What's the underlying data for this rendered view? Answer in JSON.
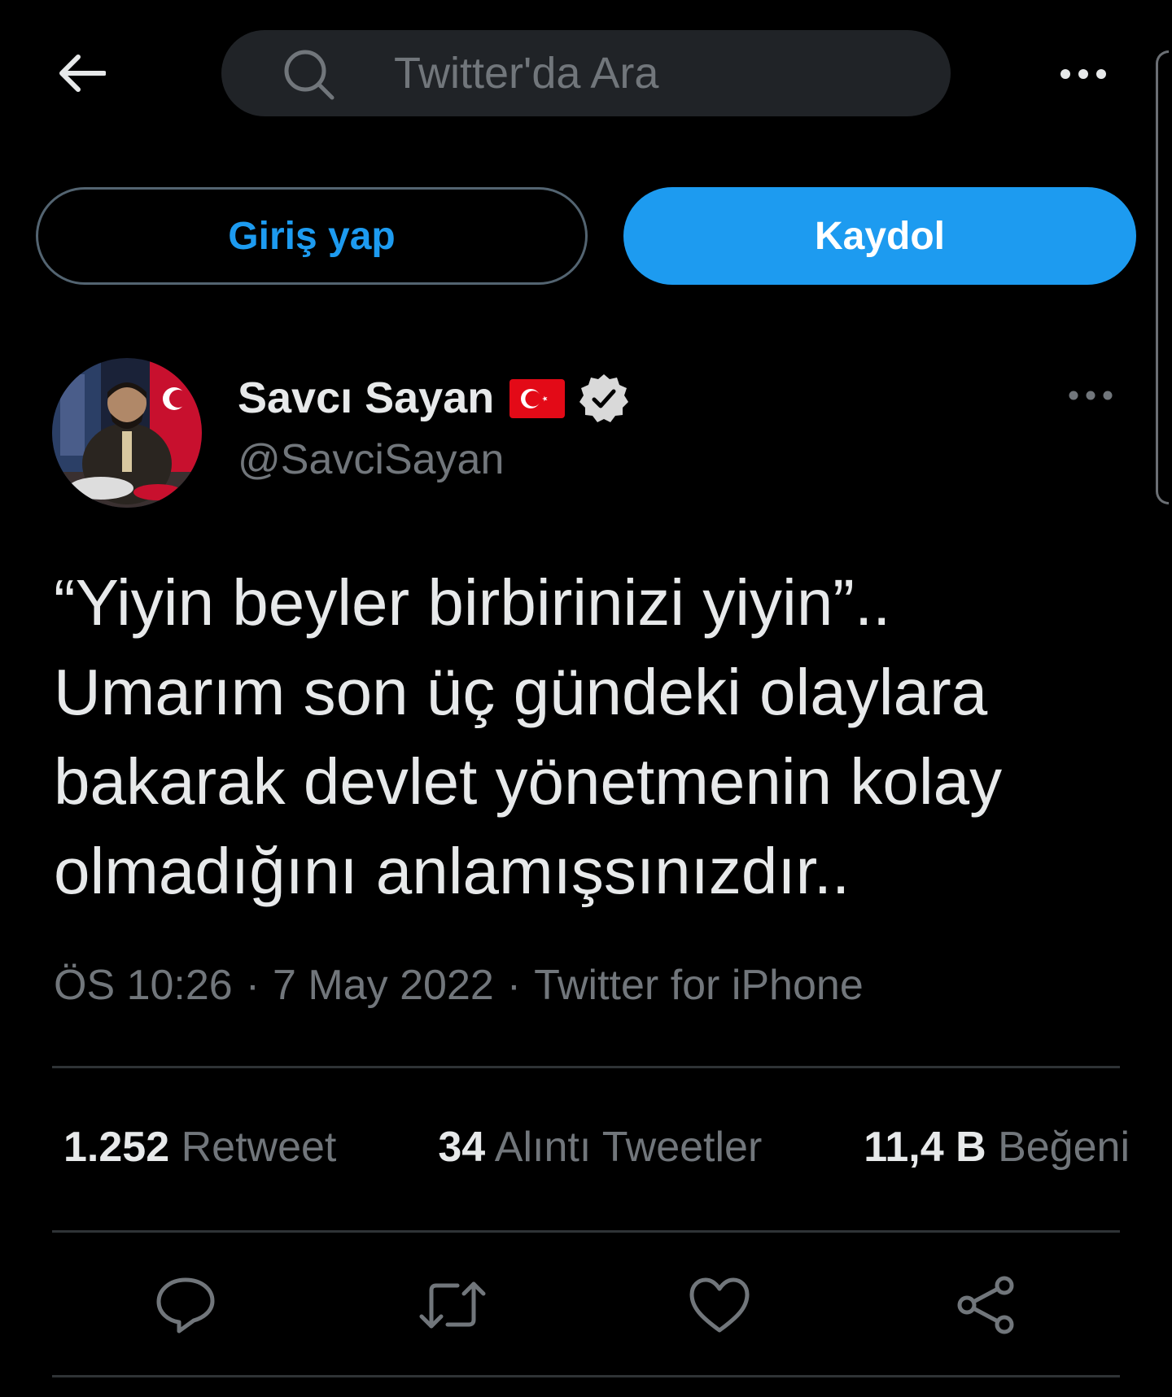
{
  "topbar": {
    "search_placeholder": "Twitter'da Ara"
  },
  "auth": {
    "login_label": "Giriş yap",
    "signup_label": "Kaydol"
  },
  "author": {
    "display_name": "Savcı Sayan",
    "handle": "@SavciSayan",
    "badges": [
      "turkey-flag-icon",
      "verified-badge-icon"
    ]
  },
  "tweet": {
    "text": "“Yiyin beyler birbirinizi yiyin”..\nUmarım son üç gündeki olaylara bakarak devlet yönetmenin kolay olmadığını anlamışsınızdır..",
    "time": "ÖS 10:26",
    "date": "7 May 2022",
    "source": "Twitter for iPhone",
    "separator": "·"
  },
  "stats": {
    "retweets_count": "1.252",
    "retweets_label": "Retweet",
    "quotes_count": "34",
    "quotes_label": "Alıntı Tweetler",
    "likes_count": "11,4 B",
    "likes_label": "Beğeni"
  },
  "actions": [
    "reply-icon",
    "retweet-icon",
    "like-icon",
    "share-icon"
  ],
  "colors": {
    "background": "#000000",
    "accent": "#1d9bf0",
    "text_primary": "#e7e9ea",
    "text_secondary": "#71767b",
    "divider": "#2f3336",
    "flag_red": "#e30a17"
  }
}
